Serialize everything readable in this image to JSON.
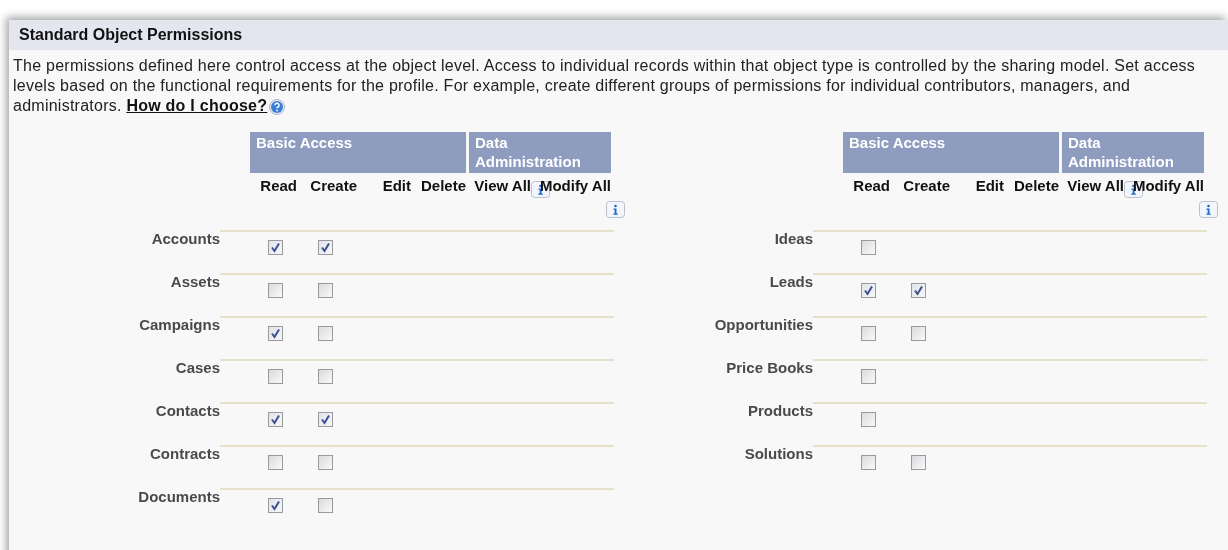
{
  "section": {
    "title": "Standard Object Permissions"
  },
  "description": {
    "text": "The permissions defined here control access at the object level. Access to individual records within that object type is controlled by the sharing model. Set access levels based on the functional requirements for the profile. For example, create different groups of permissions for individual contributors, managers, and administrators.",
    "link": "How do I choose?"
  },
  "tables": [
    {
      "groups": [
        {
          "label": "Basic Access",
          "columns": [
            {
              "label": "Read",
              "info": false
            },
            {
              "label": "Create",
              "info": false
            },
            {
              "label": "Edit",
              "info": false
            },
            {
              "label": "Delete",
              "info": false
            }
          ]
        },
        {
          "label": "Data Administration",
          "columns": [
            {
              "label": "View All",
              "info": true
            },
            {
              "label": "Modify All",
              "info": true
            }
          ]
        }
      ],
      "rows": [
        {
          "name": "Accounts",
          "permissions": [
            {
              "checked": true
            },
            {
              "checked": true
            }
          ]
        },
        {
          "name": "Assets",
          "permissions": [
            {
              "checked": false
            },
            {
              "checked": false
            }
          ]
        },
        {
          "name": "Campaigns",
          "permissions": [
            {
              "checked": true
            },
            {
              "checked": false
            }
          ]
        },
        {
          "name": "Cases",
          "permissions": [
            {
              "checked": false
            },
            {
              "checked": false
            }
          ]
        },
        {
          "name": "Contacts",
          "permissions": [
            {
              "checked": true
            },
            {
              "checked": true
            }
          ]
        },
        {
          "name": "Contracts",
          "permissions": [
            {
              "checked": false
            },
            {
              "checked": false
            }
          ]
        },
        {
          "name": "Documents",
          "permissions": [
            {
              "checked": true
            },
            {
              "checked": false
            }
          ]
        }
      ]
    },
    {
      "groups": [
        {
          "label": "Basic Access",
          "columns": [
            {
              "label": "Read",
              "info": false
            },
            {
              "label": "Create",
              "info": false
            },
            {
              "label": "Edit",
              "info": false
            },
            {
              "label": "Delete",
              "info": false
            }
          ]
        },
        {
          "label": "Data Administration",
          "columns": [
            {
              "label": "View All",
              "info": true
            },
            {
              "label": "Modify All",
              "info": true
            }
          ]
        }
      ],
      "rows": [
        {
          "name": "Ideas",
          "permissions": [
            {
              "checked": false
            }
          ]
        },
        {
          "name": "Leads",
          "permissions": [
            {
              "checked": true
            },
            {
              "checked": true
            }
          ]
        },
        {
          "name": "Opportunities",
          "permissions": [
            {
              "checked": false
            },
            {
              "checked": false
            }
          ]
        },
        {
          "name": "Price Books",
          "permissions": [
            {
              "checked": false
            }
          ]
        },
        {
          "name": "Products",
          "permissions": [
            {
              "checked": false
            }
          ]
        },
        {
          "name": "Solutions",
          "permissions": [
            {
              "checked": false
            },
            {
              "checked": false
            }
          ]
        }
      ]
    }
  ]
}
